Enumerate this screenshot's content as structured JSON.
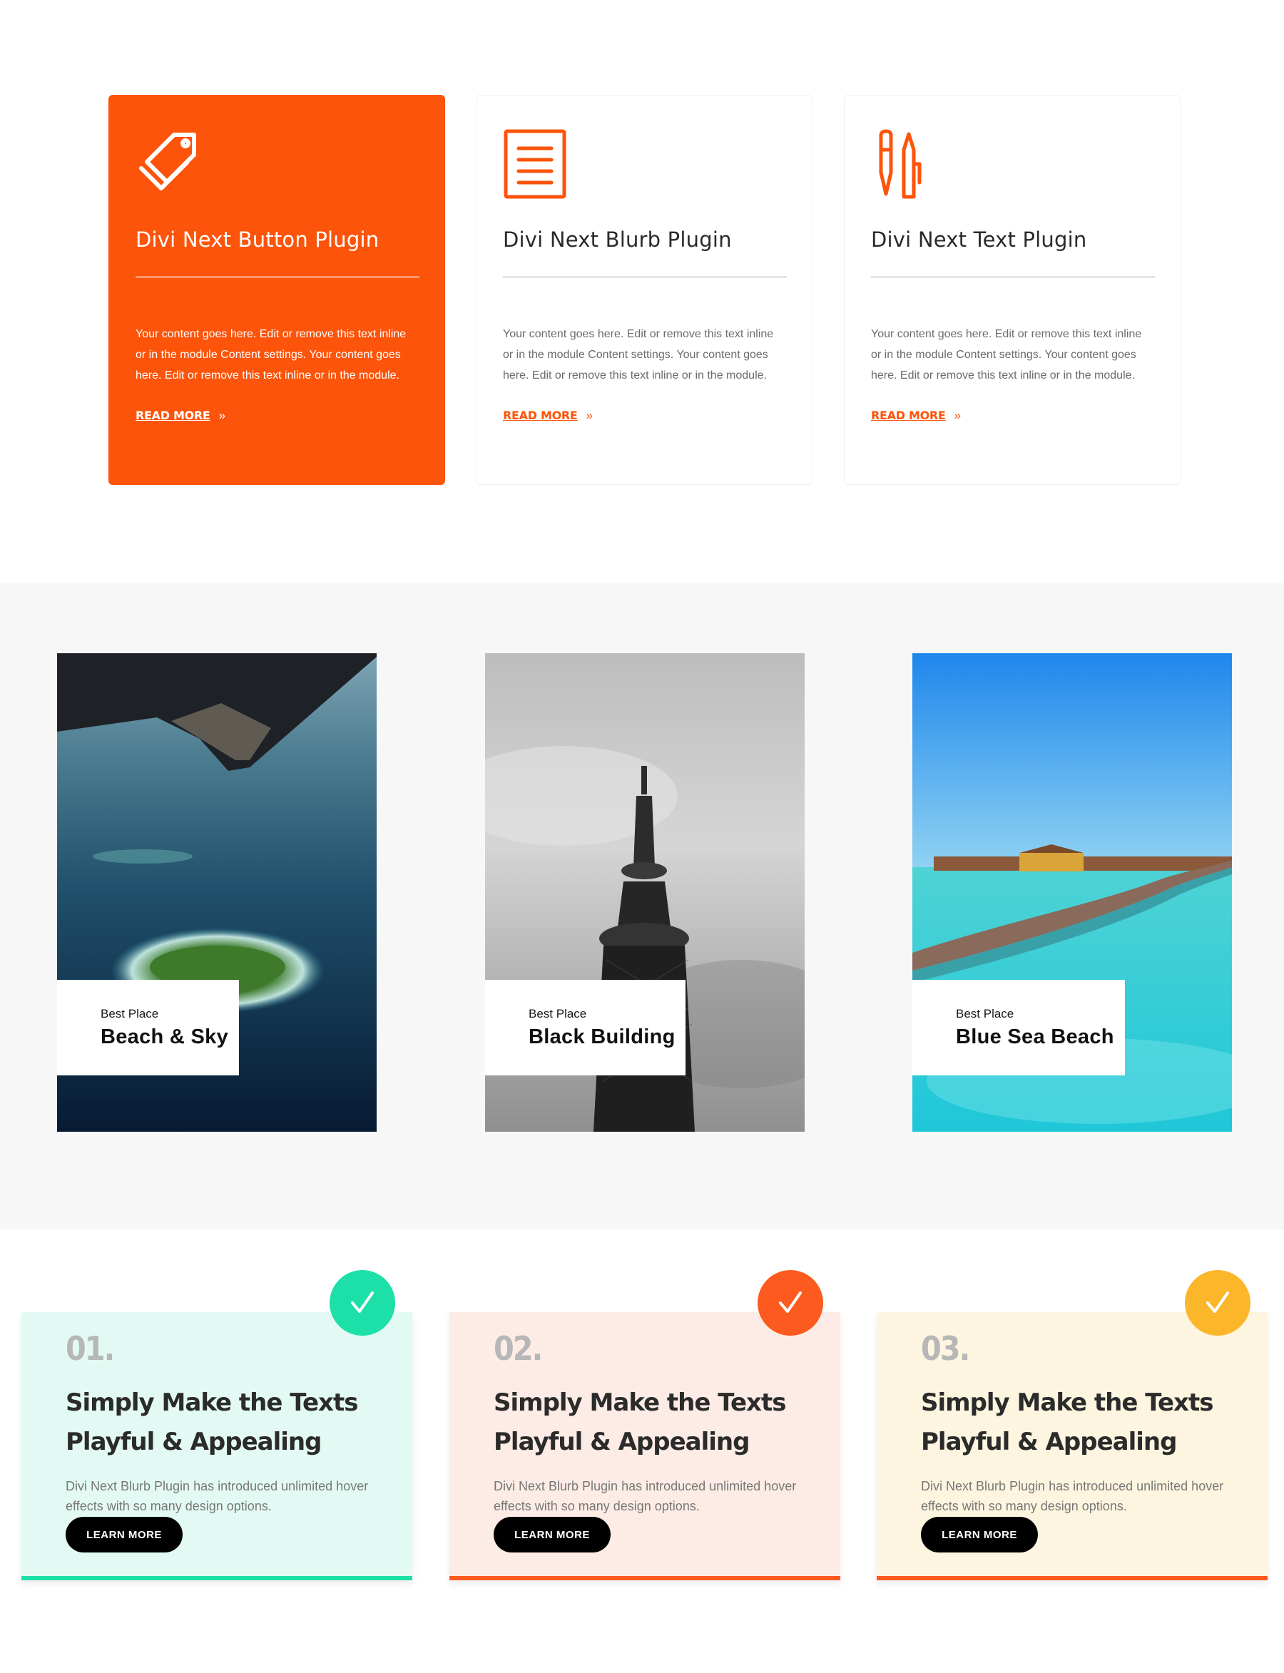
{
  "plugins": [
    {
      "icon": "tag-icon",
      "title": "Divi Next Button Plugin",
      "desc": "Your content goes here. Edit or remove this text inline or in the module Content settings. Your content goes here. Edit or remove this text inline or in the module.",
      "link": "READ MORE",
      "arrow": "»"
    },
    {
      "icon": "document-icon",
      "title": "Divi Next Blurb Plugin",
      "desc": "Your content goes here. Edit or remove this text inline or in the module Content settings. Your content goes here. Edit or remove this text inline or in the module.",
      "link": "READ MORE",
      "arrow": "»"
    },
    {
      "icon": "pencils-icon",
      "title": "Divi Next Text Plugin",
      "desc": "Your content goes here. Edit or remove this text inline or in the module Content settings. Your content goes here. Edit or remove this text inline or in the module.",
      "link": "READ MORE",
      "arrow": "»"
    }
  ],
  "places": [
    {
      "kicker": "Best Place",
      "name": "Beach & Sky"
    },
    {
      "kicker": "Best Place",
      "name": "Black Building"
    },
    {
      "kicker": "Best Place",
      "name": "Blue Sea Beach"
    }
  ],
  "features": [
    {
      "num": "01.",
      "title": "Simply Make the Texts Playful & Appealing",
      "text": "Divi Next Blurb Plugin has introduced unlimited hover effects with so many design options.",
      "button": "LEARN MORE",
      "bg": "#e2faf3",
      "accent": "#1de0a8"
    },
    {
      "num": "02.",
      "title": "Simply Make the Texts Playful & Appealing",
      "text": "Divi Next Blurb Plugin has introduced unlimited hover effects with so many design options.",
      "button": "LEARN MORE",
      "bg": "#fdece5",
      "accent": "#fc5a1e"
    },
    {
      "num": "03.",
      "title": "Simply Make the Texts Playful & Appealing",
      "text": "Divi Next Blurb Plugin has introduced unlimited hover effects with so many design options.",
      "button": "LEARN MORE",
      "bg": "#fef5e0",
      "accent": "#fcb62a"
    }
  ],
  "colors": {
    "brand_orange": "#fc540a",
    "section_gray": "#f7f7f7"
  }
}
